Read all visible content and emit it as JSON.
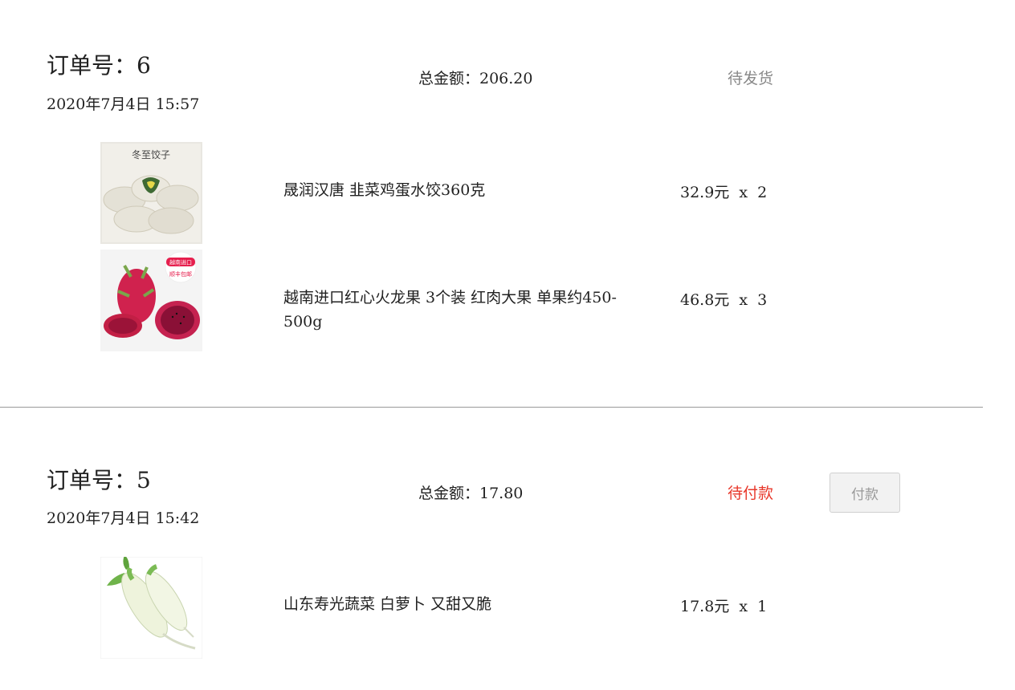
{
  "orders": [
    {
      "order_no": "订单号：6",
      "date": "2020年7月4日 15:57",
      "total": "总金额：206.20",
      "status": "待发货",
      "items": [
        {
          "name": "晟润汉唐 韭菜鸡蛋水饺360克",
          "price": "32.9元  x  2",
          "image_text": "冬至饺子"
        },
        {
          "name": "越南进口红心火龙果 3个装 红肉大果 单果约450-500g",
          "price": "46.8元  x  3",
          "badge_line1": "越南进口",
          "badge_line2": "顺丰包邮"
        }
      ]
    },
    {
      "order_no": "订单号：5",
      "date": "2020年7月4日 15:42",
      "total": "总金额：17.80",
      "status": "待付款",
      "pay_label": "付款",
      "items": [
        {
          "name": "山东寿光蔬菜 白萝卜 又甜又脆",
          "price": "17.8元  x  1"
        }
      ]
    }
  ],
  "colors": {
    "status_pending_ship": "#888888",
    "status_pending_pay": "#e8372a",
    "divider": "#999999"
  }
}
